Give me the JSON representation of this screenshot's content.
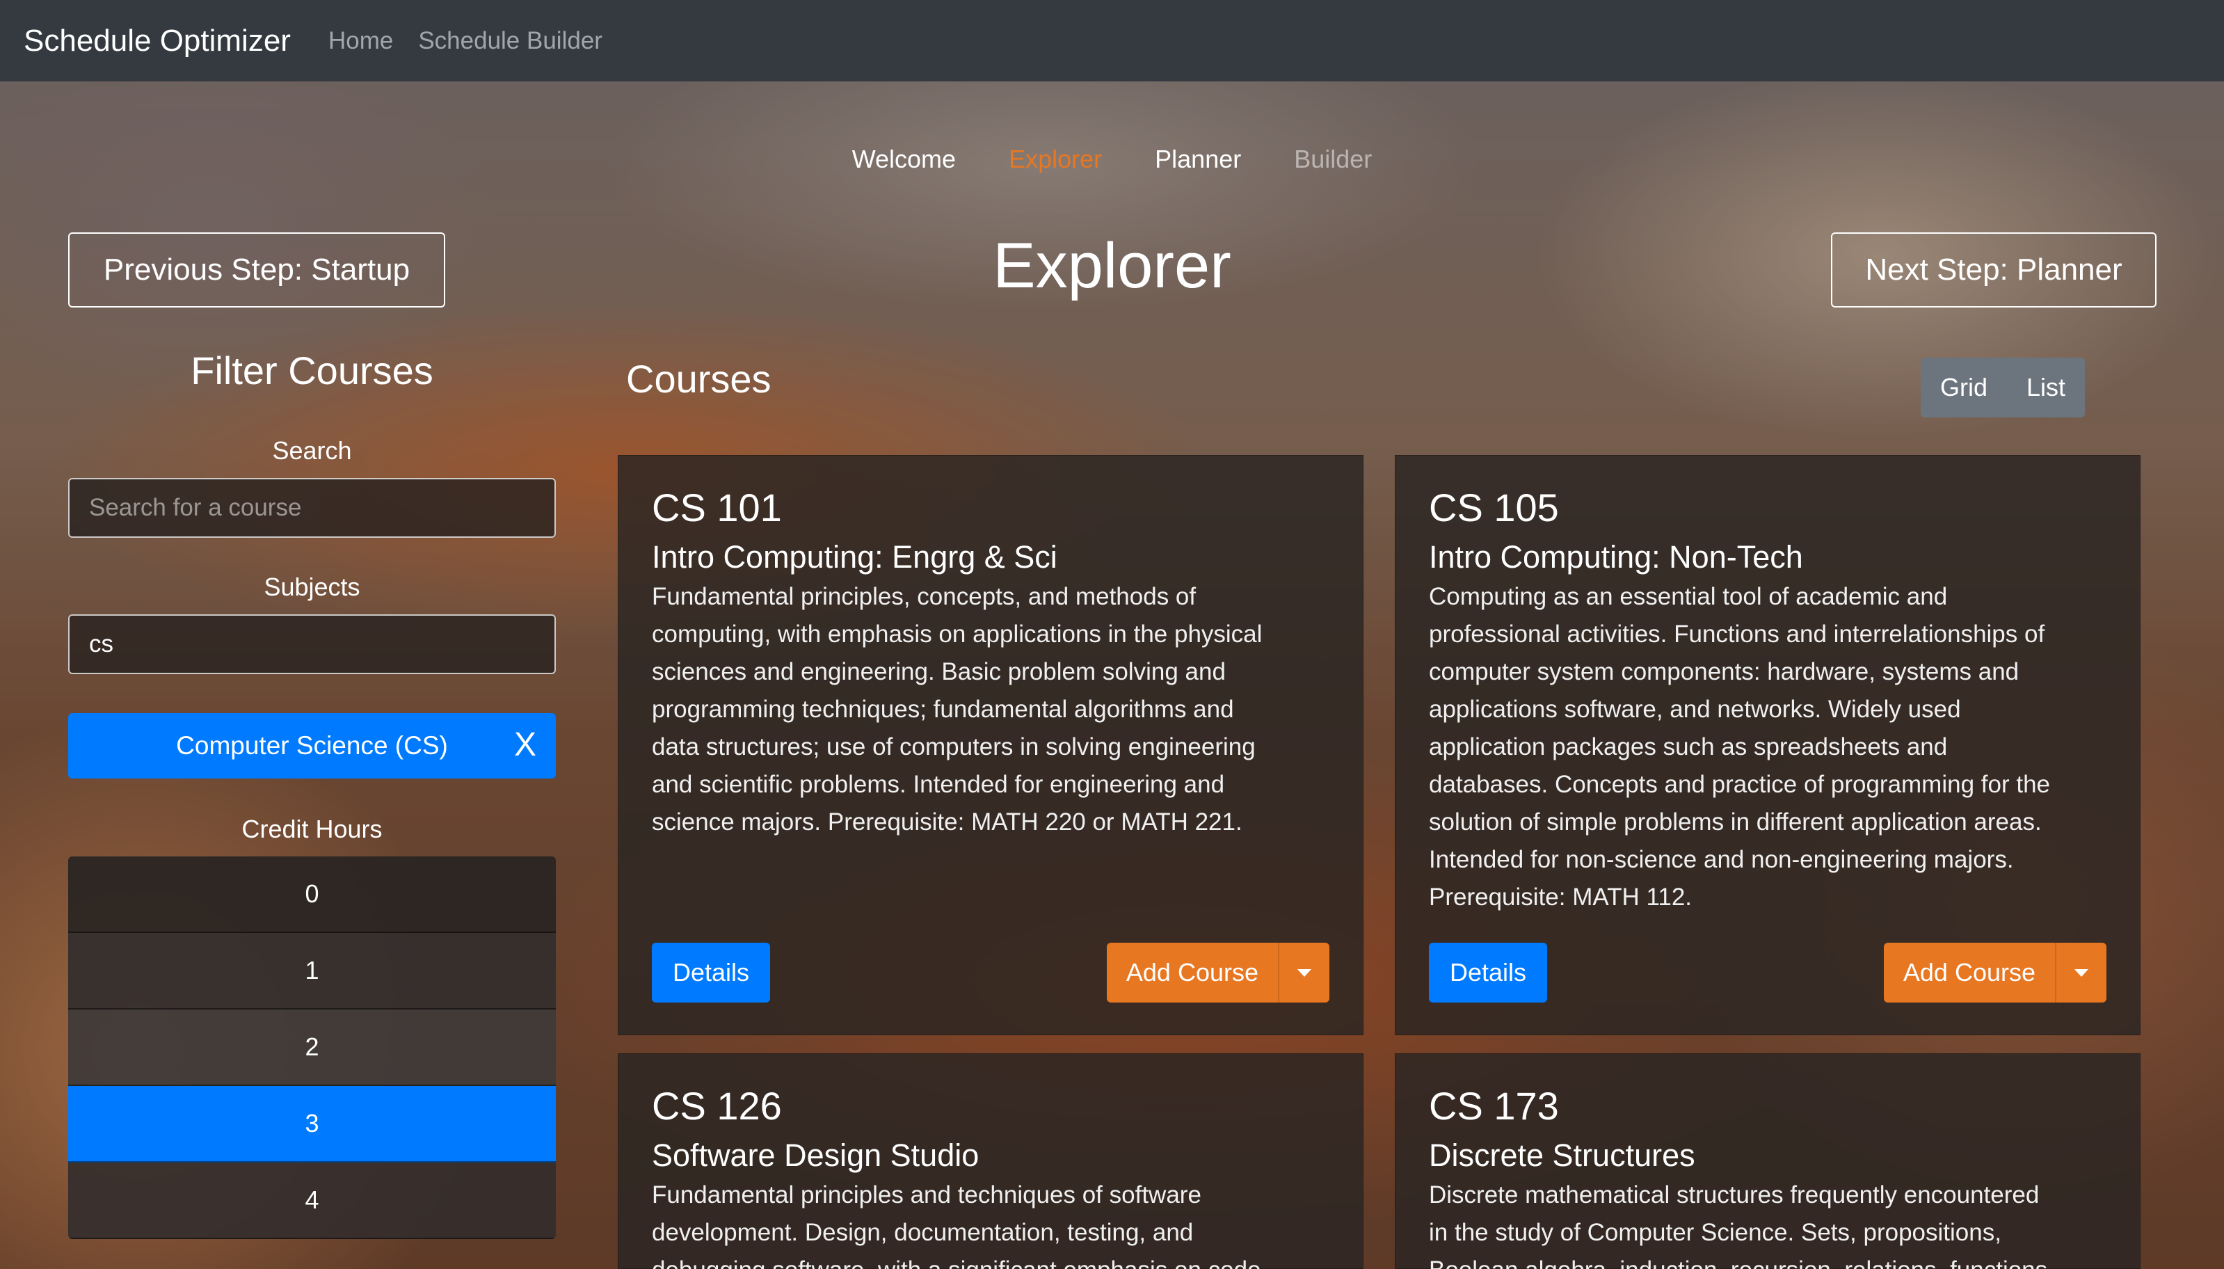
{
  "navbar": {
    "brand": "Schedule Optimizer",
    "links": [
      "Home",
      "Schedule Builder"
    ]
  },
  "steps": {
    "items": [
      "Welcome",
      "Explorer",
      "Planner",
      "Builder"
    ],
    "active": "Explorer",
    "disabled": "Builder"
  },
  "page": {
    "title": "Explorer",
    "prev_button": "Previous Step: Startup",
    "next_button": "Next Step: Planner"
  },
  "filters": {
    "heading": "Filter Courses",
    "search_label": "Search",
    "search_placeholder": "Search for a course",
    "subjects_label": "Subjects",
    "subjects_value": "cs",
    "selected_subject": "Computer Science (CS)",
    "remove_label": "X",
    "credit_label": "Credit Hours",
    "credit_options": [
      "0",
      "1",
      "2",
      "3",
      "4"
    ],
    "credit_selected": "3"
  },
  "courses": {
    "heading": "Courses",
    "view_toggle": [
      "Grid",
      "List"
    ],
    "details_label": "Details",
    "add_label": "Add Course",
    "items": [
      {
        "code": "CS 101",
        "title": "Intro Computing: Engrg & Sci",
        "lines": [
          "Fundamental principles, concepts, and methods of",
          "computing, with emphasis on applications in the physical",
          "sciences and engineering. Basic problem solving and",
          "programming techniques; fundamental algorithms and",
          "data structures; use of computers in solving engineering",
          "and scientific problems. Intended for engineering and",
          "science majors. Prerequisite: MATH 220 or MATH 221."
        ]
      },
      {
        "code": "CS 105",
        "title": "Intro Computing: Non-Tech",
        "lines": [
          "Computing as an essential tool of academic and",
          "professional activities. Functions and interrelationships of",
          "computer system components: hardware, systems and",
          "applications software, and networks. Widely used",
          "application packages such as spreadsheets and",
          "databases. Concepts and practice of programming for the",
          "solution of simple problems in different application areas.",
          "Intended for non-science and non-engineering majors.",
          "Prerequisite: MATH 112."
        ]
      },
      {
        "code": "CS 126",
        "title": "Software Design Studio",
        "lines": [
          "Fundamental principles and techniques of software",
          "development. Design, documentation, testing, and",
          "debugging software, with a significant emphasis on code"
        ]
      },
      {
        "code": "CS 173",
        "title": "Discrete Structures",
        "lines": [
          "Discrete mathematical structures frequently encountered",
          "in the study of Computer Science. Sets, propositions,",
          "Boolean algebra, induction, recursion, relations, functions"
        ]
      }
    ]
  },
  "colors": {
    "navbar": "#343a40",
    "accent_orange": "#e87722",
    "primary_blue": "#007bff",
    "toggle_gray": "#6c757d"
  }
}
